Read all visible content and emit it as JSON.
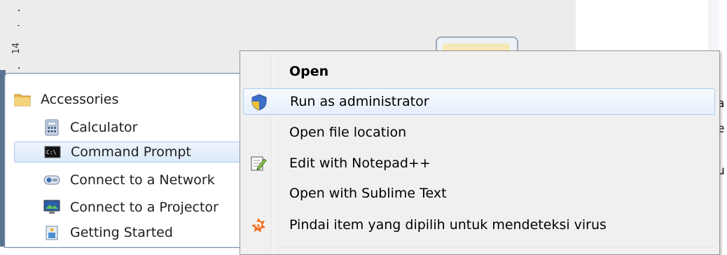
{
  "ruler": {
    "number": "14"
  },
  "start_menu": {
    "items": [
      {
        "label": "Accessories",
        "icon": "folder-icon"
      },
      {
        "label": "Calculator",
        "icon": "calculator-icon"
      },
      {
        "label": "Command Prompt",
        "icon": "command-prompt-icon"
      },
      {
        "label": "Connect to a Network",
        "icon": "network-projector-icon"
      },
      {
        "label": "Connect to a Projector",
        "icon": "projector-icon"
      },
      {
        "label": "Getting Started",
        "icon": "getting-started-icon"
      }
    ]
  },
  "context_menu": {
    "items": [
      {
        "label": "Open",
        "icon": ""
      },
      {
        "label": "Run as administrator",
        "icon": "uac-shield-icon"
      },
      {
        "label": "Open file location",
        "icon": ""
      },
      {
        "label": "Edit with Notepad++",
        "icon": "notepad-plus-plus-icon"
      },
      {
        "label": "Open with Sublime Text",
        "icon": ""
      },
      {
        "label": "Pindai item yang dipilih untuk mendeteksi virus",
        "icon": "avast-icon"
      }
    ]
  },
  "doc_right": {
    "letters": [
      "a",
      "e",
      "u"
    ]
  },
  "colors": {
    "menu_bg": "#f0f0f0",
    "highlight_border": "#aeccf0",
    "selection_bg": "#dceaf9"
  }
}
